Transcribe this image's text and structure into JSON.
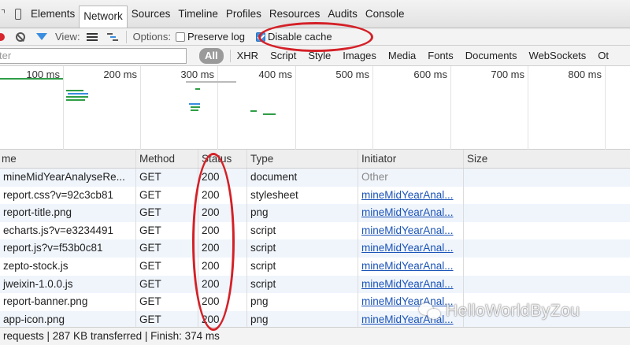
{
  "tabs": [
    "Elements",
    "Network",
    "Sources",
    "Timeline",
    "Profiles",
    "Resources",
    "Audits",
    "Console"
  ],
  "active_tab": "Network",
  "toolbar": {
    "view_label": "View:",
    "options_label": "Options:",
    "preserve_log": "Preserve log",
    "disable_cache": "Disable cache"
  },
  "filter": {
    "placeholder": "ter",
    "types": [
      "All",
      "XHR",
      "Script",
      "Style",
      "Images",
      "Media",
      "Fonts",
      "Documents",
      "WebSockets",
      "Ot"
    ]
  },
  "timeline": {
    "ticks": [
      "100 ms",
      "200 ms",
      "300 ms",
      "400 ms",
      "500 ms",
      "600 ms",
      "700 ms",
      "800 ms"
    ]
  },
  "table": {
    "headers": [
      "me",
      "Method",
      "Status",
      "Type",
      "Initiator",
      "Size"
    ],
    "rows": [
      {
        "name": "mineMidYearAnalyseRe...",
        "method": "GET",
        "status": "200",
        "type": "document",
        "initiator": "Other"
      },
      {
        "name": "report.css?v=92c3cb81",
        "method": "GET",
        "status": "200",
        "type": "stylesheet",
        "initiator": "mineMidYearAnal..."
      },
      {
        "name": "report-title.png",
        "method": "GET",
        "status": "200",
        "type": "png",
        "initiator": "mineMidYearAnal..."
      },
      {
        "name": "echarts.js?v=e3234491",
        "method": "GET",
        "status": "200",
        "type": "script",
        "initiator": "mineMidYearAnal..."
      },
      {
        "name": "report.js?v=f53b0c81",
        "method": "GET",
        "status": "200",
        "type": "script",
        "initiator": "mineMidYearAnal..."
      },
      {
        "name": "zepto-stock.js",
        "method": "GET",
        "status": "200",
        "type": "script",
        "initiator": "mineMidYearAnal..."
      },
      {
        "name": "jweixin-1.0.0.js",
        "method": "GET",
        "status": "200",
        "type": "script",
        "initiator": "mineMidYearAnal..."
      },
      {
        "name": "report-banner.png",
        "method": "GET",
        "status": "200",
        "type": "png",
        "initiator": "mineMidYearAnal..."
      },
      {
        "name": "app-icon.png",
        "method": "GET",
        "status": "200",
        "type": "png",
        "initiator": "mineMidYearAnal..."
      }
    ]
  },
  "statusbar": "requests  |  287 KB transferred  |  Finish: 374 ms",
  "watermark": "HelloWorldByZou",
  "colors": {
    "accent": "#3a8de0",
    "link": "#1a53b8",
    "annotation": "#d42027",
    "record": "#d8262f",
    "bar_green": "#2e9e46",
    "bar_blue": "#3a8de0"
  }
}
